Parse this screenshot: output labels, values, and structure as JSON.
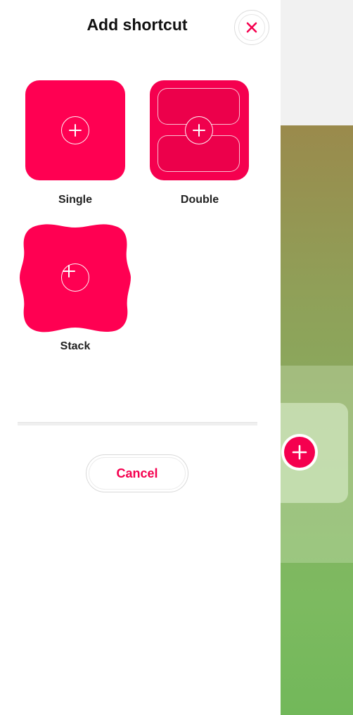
{
  "sheet": {
    "title": "Add shortcut",
    "close_icon": "close-icon",
    "cancel_label": "Cancel"
  },
  "tiles": [
    {
      "label": "Single",
      "icon": "plus-icon"
    },
    {
      "label": "Double",
      "icon": "plus-icon"
    },
    {
      "label": "Stack",
      "icon": "plus-icon"
    }
  ],
  "background": {
    "add_button_icon": "plus-icon"
  },
  "colors": {
    "accent": "#f5004f",
    "tile": "#ff0052"
  }
}
